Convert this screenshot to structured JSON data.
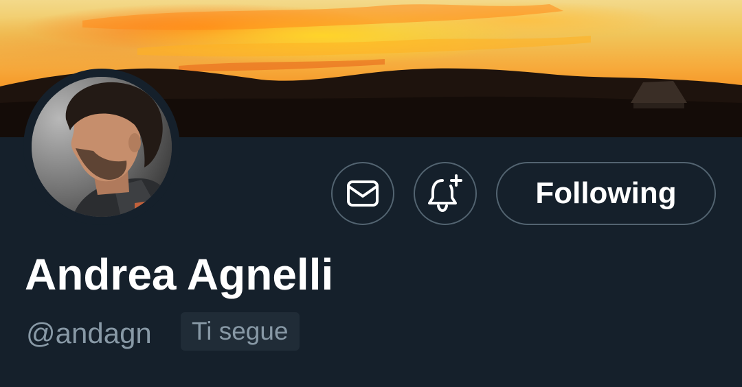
{
  "profile": {
    "name": "Andrea Agnelli",
    "handle": "@andagn",
    "follows_you_badge": "Ti segue"
  },
  "actions": {
    "message_icon": "envelope-icon",
    "notify_icon": "bell-plus-icon",
    "follow_label": "Following"
  },
  "colors": {
    "background": "#15202b",
    "button_border": "#536471",
    "muted_text": "#8899a6"
  }
}
